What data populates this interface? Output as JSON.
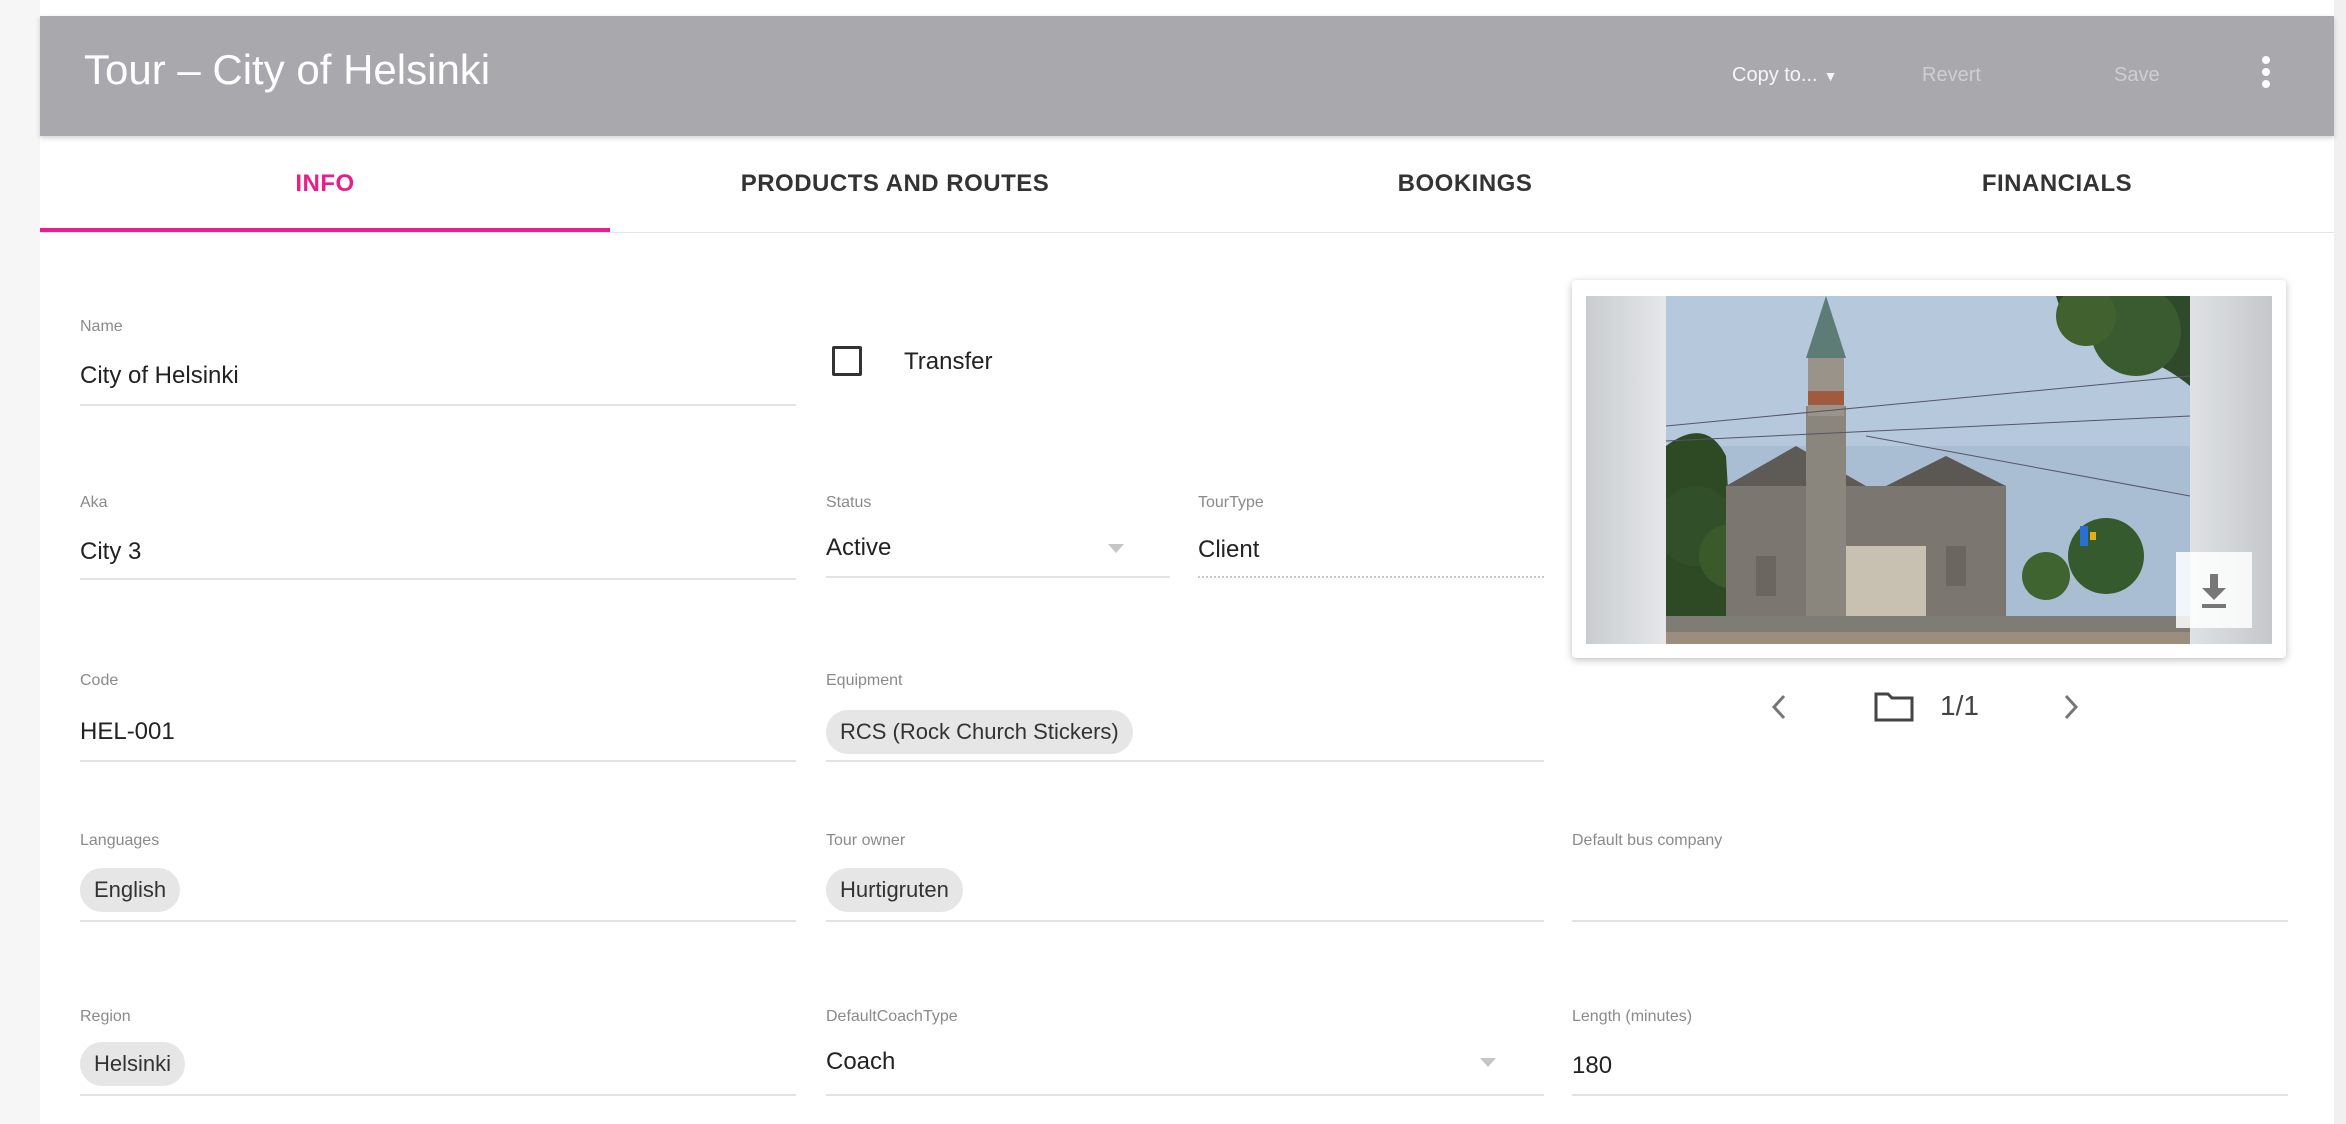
{
  "appbar": {
    "title": "Tour – City of Helsinki",
    "copy_to_label": "Copy to...",
    "revert_label": "Revert",
    "save_label": "Save",
    "more_icon": "more-vert-icon",
    "background_color": "#a9a8ac"
  },
  "tabs": [
    {
      "label": "INFO",
      "active": true
    },
    {
      "label": "PRODUCTS AND ROUTES",
      "active": false
    },
    {
      "label": "BOOKINGS",
      "active": false
    },
    {
      "label": "FINANCIALS",
      "active": false
    }
  ],
  "accent_color": "#e91e8c",
  "form": {
    "name": {
      "label": "Name",
      "value": "City of Helsinki"
    },
    "transfer": {
      "label": "Transfer",
      "checked": false
    },
    "aka": {
      "label": "Aka",
      "value": "City 3"
    },
    "status": {
      "label": "Status",
      "value": "Active"
    },
    "tour_type": {
      "label": "TourType",
      "value": "Client"
    },
    "code": {
      "label": "Code",
      "value": "HEL-001"
    },
    "equipment": {
      "label": "Equipment",
      "chips": [
        "RCS (Rock Church Stickers)"
      ]
    },
    "languages": {
      "label": "Languages",
      "chips": [
        "English"
      ]
    },
    "tour_owner": {
      "label": "Tour owner",
      "chips": [
        "Hurtigruten"
      ]
    },
    "default_bus_company": {
      "label": "Default bus company",
      "value": ""
    },
    "region": {
      "label": "Region",
      "chips": [
        "Helsinki"
      ]
    },
    "default_coach_type": {
      "label": "DefaultCoachType",
      "value": "Coach"
    },
    "length": {
      "label": "Length (minutes)",
      "value": "180"
    }
  },
  "gallery": {
    "counter": "1/1",
    "prev_icon": "chevron-left-icon",
    "next_icon": "chevron-right-icon",
    "folder_icon": "folder-icon",
    "download_icon": "download-icon"
  }
}
